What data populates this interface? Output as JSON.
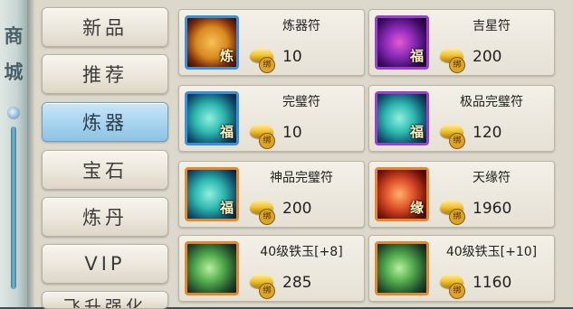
{
  "shop_title": [
    "商",
    "城"
  ],
  "categories": [
    {
      "label": "新品",
      "active": false
    },
    {
      "label": "推荐",
      "active": false
    },
    {
      "label": "炼器",
      "active": true
    },
    {
      "label": "宝石",
      "active": false
    },
    {
      "label": "炼丹",
      "active": false
    },
    {
      "label": "VIP",
      "active": false
    },
    {
      "label": "飞升强化",
      "active": false
    }
  ],
  "bind_label": "绑",
  "items": [
    {
      "name": "炼器符",
      "price": "10",
      "icon": "orange-scroll-icon",
      "frame": "blue",
      "icon_char": "炼"
    },
    {
      "name": "吉星符",
      "price": "200",
      "icon": "purple-scroll-icon",
      "frame": "purple",
      "icon_char": "福"
    },
    {
      "name": "完璧符",
      "price": "10",
      "icon": "teal-scroll-icon",
      "frame": "blue",
      "icon_char": "福"
    },
    {
      "name": "极品完璧符",
      "price": "120",
      "icon": "teal-scroll-icon",
      "frame": "purple",
      "icon_char": "福"
    },
    {
      "name": "神品完璧符",
      "price": "200",
      "icon": "teal-scroll-icon",
      "frame": "orange",
      "icon_char": "福"
    },
    {
      "name": "天缘符",
      "price": "1960",
      "icon": "red-scroll-icon",
      "frame": "orange",
      "icon_char": "缘"
    },
    {
      "name": "40级铁玉[+8]",
      "price": "285",
      "icon": "green-jade-icon",
      "frame": "orange",
      "icon_char": ""
    },
    {
      "name": "40级铁玉[+10]",
      "price": "1160",
      "icon": "green-jade-icon",
      "frame": "orange",
      "icon_char": ""
    }
  ],
  "colors": {
    "tab_active": "#a7d3ef",
    "frame_blue": "#3a8fe0",
    "frame_purple": "#9a3fd0",
    "frame_orange": "#e8862c",
    "gold": "#f2c530"
  }
}
